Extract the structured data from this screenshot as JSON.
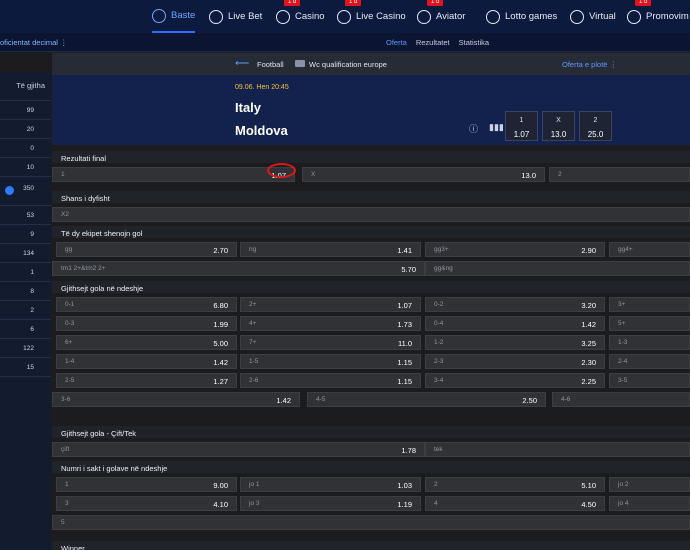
{
  "topnav": {
    "items": [
      {
        "label": "Baste",
        "icon": "soccer-ball-icon",
        "active": true,
        "badge": ""
      },
      {
        "label": "Live Bet",
        "icon": "live-icon",
        "active": false,
        "badge": ""
      },
      {
        "label": "Casino",
        "icon": "cherries-icon",
        "active": false,
        "badge": "1 d"
      },
      {
        "label": "Live Casino",
        "icon": "chip-icon",
        "active": false,
        "badge": "1 d"
      },
      {
        "label": "Aviator",
        "icon": "plane-icon",
        "active": false,
        "badge": "1 d"
      },
      {
        "label": "Lotto games",
        "icon": "lotto-icon",
        "active": false,
        "badge": ""
      },
      {
        "label": "Virtual",
        "icon": "virtual-icon",
        "active": false,
        "badge": ""
      },
      {
        "label": "Promovim",
        "icon": "megaphone-icon",
        "active": false,
        "badge": "1 d"
      }
    ]
  },
  "subnav": {
    "odds_format": "oficientat decimal",
    "tabs": [
      {
        "label": "Oferta",
        "active": true
      },
      {
        "label": "Rezultatet",
        "active": false
      },
      {
        "label": "Statistika",
        "active": false
      }
    ]
  },
  "sidebar": {
    "all_label": "Të gjitha",
    "counts": [
      "99",
      "20",
      "0",
      "10",
      "350",
      "53",
      "9",
      "134",
      "1",
      "8",
      "2",
      "6",
      "122",
      "15"
    ]
  },
  "breadcrumb": {
    "sport": "Football",
    "competition": "Wc qualification europe",
    "full_offer": "Oferta e plotë"
  },
  "event": {
    "time": "09.06. Hen 20:45",
    "home": "Italy",
    "away": "Moldova",
    "odds": [
      {
        "label": "1",
        "value": "1.07"
      },
      {
        "label": "X",
        "value": "13.0"
      },
      {
        "label": "2",
        "value": "25.0"
      }
    ]
  },
  "markets": [
    {
      "title": "Rezultati final",
      "rows": [
        [
          {
            "label": "1",
            "value": "1.07"
          },
          {
            "label": "X",
            "value": "13.0"
          },
          {
            "label": "2",
            "value": ""
          }
        ]
      ]
    },
    {
      "title": "Shans i dyfisht",
      "rows": [
        [
          {
            "label": "X2",
            "value": ""
          }
        ]
      ]
    },
    {
      "title": "Të dy ekipet shenojn gol",
      "rows": [
        [
          {
            "label": "gg",
            "value": "2.70"
          },
          {
            "label": "ng",
            "value": "1.41"
          },
          {
            "label": "gg3+",
            "value": "2.90"
          },
          {
            "label": "gg4+",
            "value": ""
          }
        ],
        [
          {
            "label": "tm1 2+&tm2 2+",
            "value": "5.70"
          },
          {
            "label": "gg&ng",
            "value": ""
          }
        ]
      ]
    },
    {
      "title": "Gjithsejt gola në ndeshje",
      "rows": [
        [
          {
            "label": "0-1",
            "value": "6.80"
          },
          {
            "label": "2+",
            "value": "1.07"
          },
          {
            "label": "0-2",
            "value": "3.20"
          },
          {
            "label": "3+",
            "value": ""
          }
        ],
        [
          {
            "label": "0-3",
            "value": "1.99"
          },
          {
            "label": "4+",
            "value": "1.73"
          },
          {
            "label": "0-4",
            "value": "1.42"
          },
          {
            "label": "5+",
            "value": ""
          }
        ],
        [
          {
            "label": "6+",
            "value": "5.00"
          },
          {
            "label": "7+",
            "value": "11.0"
          },
          {
            "label": "1-2",
            "value": "3.25"
          },
          {
            "label": "1-3",
            "value": ""
          }
        ],
        [
          {
            "label": "1-4",
            "value": "1.42"
          },
          {
            "label": "1-5",
            "value": "1.15"
          },
          {
            "label": "2-3",
            "value": "2.30"
          },
          {
            "label": "2-4",
            "value": ""
          }
        ],
        [
          {
            "label": "2-5",
            "value": "1.27"
          },
          {
            "label": "2-6",
            "value": "1.15"
          },
          {
            "label": "3-4",
            "value": "2.25"
          },
          {
            "label": "3-5",
            "value": ""
          }
        ],
        [
          {
            "label": "3-6",
            "value": "1.42"
          },
          {
            "label": "4-5",
            "value": "2.50"
          },
          {
            "label": "4-6",
            "value": ""
          }
        ]
      ]
    },
    {
      "title": "Gjithsejt gola - Çift/Tek",
      "rows": [
        [
          {
            "label": "çift",
            "value": "1.78"
          },
          {
            "label": "tek",
            "value": ""
          }
        ]
      ]
    },
    {
      "title": "Numri i sakt i golave në ndeshje",
      "rows": [
        [
          {
            "label": "1",
            "value": "9.00"
          },
          {
            "label": "jo 1",
            "value": "1.03"
          },
          {
            "label": "2",
            "value": "5.10"
          },
          {
            "label": "jo 2",
            "value": ""
          }
        ],
        [
          {
            "label": "3",
            "value": "4.10"
          },
          {
            "label": "jo 3",
            "value": "1.19"
          },
          {
            "label": "4",
            "value": "4.50"
          },
          {
            "label": "jo 4",
            "value": ""
          }
        ],
        [
          {
            "label": "5",
            "value": ""
          }
        ]
      ]
    },
    {
      "title": "Winner",
      "rows": []
    }
  ]
}
